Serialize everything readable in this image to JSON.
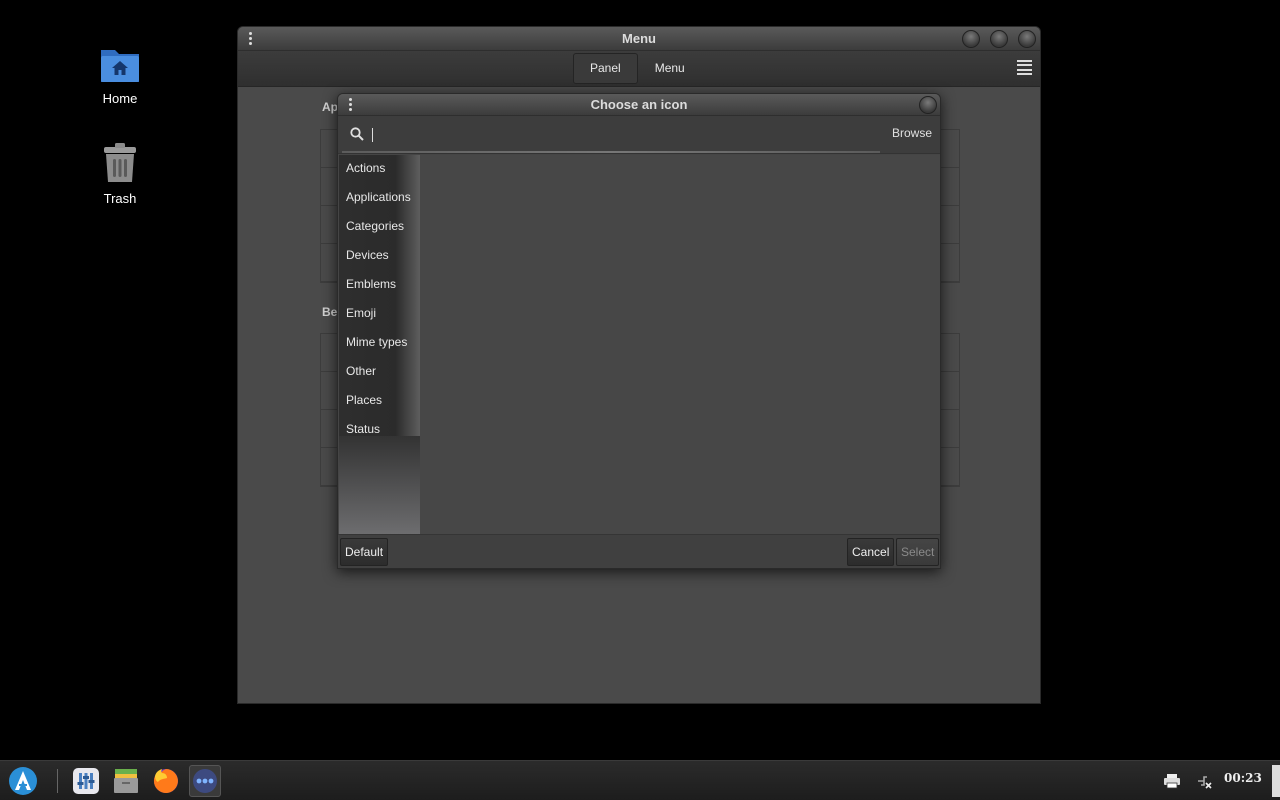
{
  "desktop": {
    "icons": [
      {
        "label": "Home",
        "icon": "home-folder-icon"
      },
      {
        "label": "Trash",
        "icon": "trash-icon"
      }
    ]
  },
  "main_window": {
    "title": "Menu",
    "tabs": [
      {
        "label": "Panel",
        "active": true
      },
      {
        "label": "Menu",
        "active": false
      }
    ],
    "section1_heading": "Ap",
    "section2_heading": "Be"
  },
  "dialog": {
    "title": "Choose an icon",
    "search": {
      "value": "",
      "placeholder": ""
    },
    "browse_label": "Browse",
    "categories": [
      "Actions",
      "Applications",
      "Categories",
      "Devices",
      "Emblems",
      "Emoji",
      "Mime types",
      "Other",
      "Places",
      "Status"
    ],
    "footer": {
      "default_label": "Default",
      "cancel_label": "Cancel",
      "select_label": "Select"
    }
  },
  "taskbar": {
    "apps": [
      "arch-menu-icon",
      "settings-manager-icon",
      "file-manager-icon",
      "firefox-icon",
      "more-apps-icon"
    ],
    "clock": "00:23",
    "tray": [
      "printer-icon",
      "network-disconnected-icon"
    ]
  },
  "colors": {
    "window_bg": "#4a4a4a",
    "titlebar": "#3c3c3c",
    "desktop_bg": "#000000",
    "folder_blue": "#3f7fd4"
  }
}
